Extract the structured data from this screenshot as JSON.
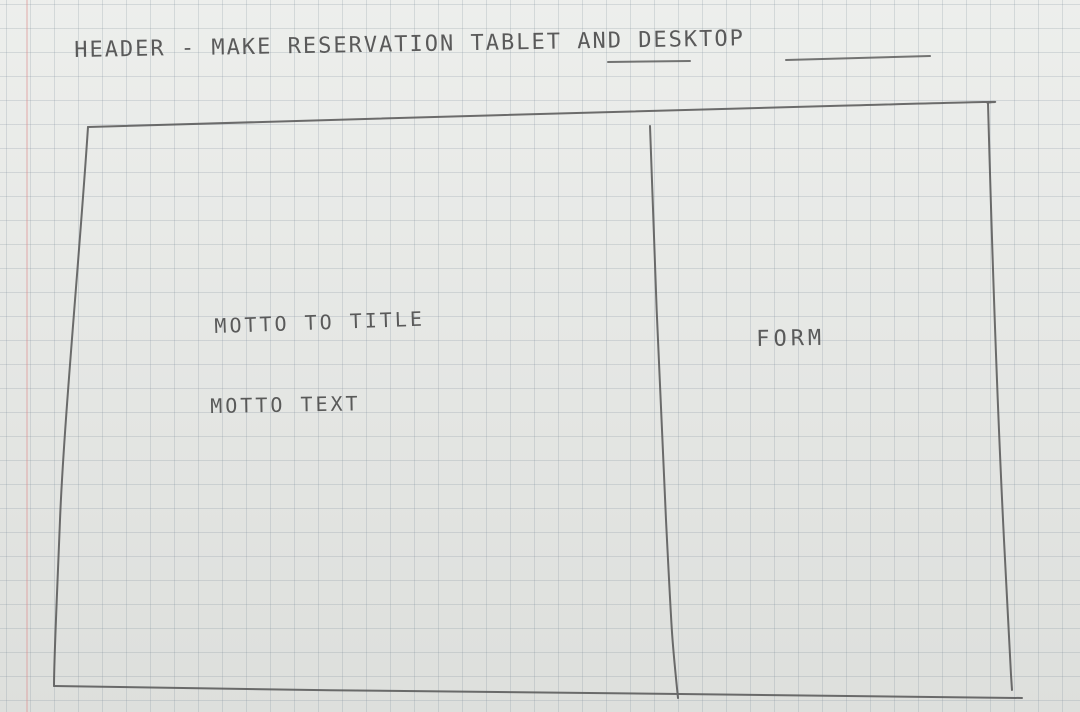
{
  "sketch": {
    "header_label": "HEADER - MAKE RESERVATION TABLET AND DESKTOP",
    "motto_title_label": "MOTTO TO TITLE",
    "motto_text_label": "MOTTO TEXT",
    "form_label": "FORM"
  },
  "colors": {
    "pencil": "#4b4b4b",
    "paper": "#e9ebe8",
    "grid": "#8898a6"
  }
}
